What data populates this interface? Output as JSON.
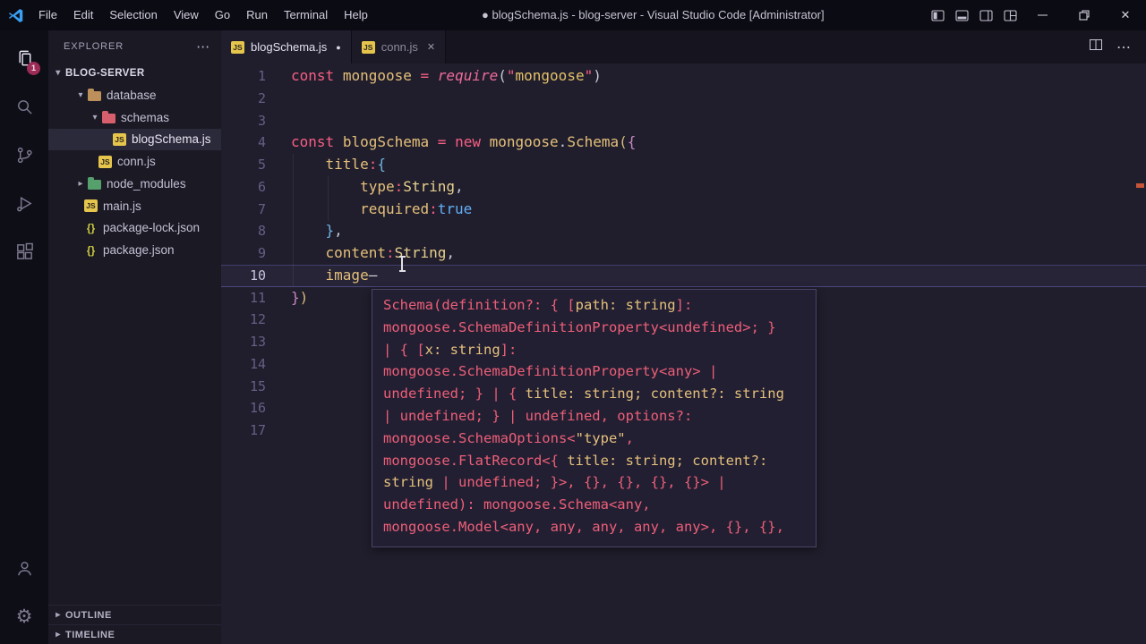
{
  "palette": {
    "titlebar_bg": "#0b0b13",
    "activity_bg": "#0e0e17",
    "sidebar_bg": "#1a1924",
    "sidebar_sel": "#2b2a3a",
    "editor_bg": "#201e2c",
    "tabbar_bg": "#16151f",
    "tab_inactive_fg": "#8d89a0",
    "tab_active_fg": "#e3e0ef",
    "popup_bg": "#221f33",
    "popup_border": "#4a4466",
    "linenum": "#655f85",
    "linenum_active": "#c6c2dd",
    "badge_bg": "#9c2b56",
    "tok_keyword": "#f85e84",
    "tok_ident": "#e5c07b",
    "tok_fn": "#ef6b9a",
    "tok_type": "#e8d08f",
    "tok_string": "#e3c06a",
    "tok_bool": "#64aef5",
    "tok_punct": "#c5cad6",
    "tok_brA": "#d7ba7d",
    "tok_brB": "#c586c0",
    "tok_brC": "#6fb3e0",
    "tok_cursor": "#dcdce4",
    "hint_red": "#ee5f77",
    "hint_yellow": "#e5c07b",
    "ruler_mark": "#c5543a"
  },
  "icons": {
    "more_h": "⋯",
    "close": "✕",
    "chevron_down": "▾",
    "chevron_right": "▸",
    "dot": "●",
    "gear": "⚙"
  },
  "titlebar": {
    "menus": [
      "File",
      "Edit",
      "Selection",
      "View",
      "Go",
      "Run",
      "Terminal",
      "Help"
    ],
    "title": "● blogSchema.js - blog-server - Visual Studio Code [Administrator]"
  },
  "activity_bar": {
    "badge": "1",
    "items": [
      "explorer",
      "search",
      "source-control",
      "run-and-debug",
      "extensions"
    ],
    "bottom_items": [
      "accounts",
      "settings"
    ]
  },
  "sidebar": {
    "header": "EXPLORER",
    "root_label": "BLOG-SERVER",
    "items": [
      {
        "label": "database",
        "kind": "folder",
        "depth": 1,
        "expanded": true,
        "color": "#bd8f5a"
      },
      {
        "label": "schemas",
        "kind": "folder",
        "depth": 2,
        "expanded": true,
        "color": "#d75f6d"
      },
      {
        "label": "blogSchema.js",
        "kind": "js",
        "depth": 3,
        "selected": true
      },
      {
        "label": "conn.js",
        "kind": "js",
        "depth": 2
      },
      {
        "label": "node_modules",
        "kind": "folder",
        "depth": 1,
        "expanded": false,
        "color": "#56a06d"
      },
      {
        "label": "main.js",
        "kind": "js",
        "depth": 1
      },
      {
        "label": "package-lock.json",
        "kind": "json",
        "depth": 1
      },
      {
        "label": "package.json",
        "kind": "json",
        "depth": 1
      }
    ],
    "sections": [
      "OUTLINE",
      "TIMELINE"
    ]
  },
  "editor": {
    "tabs": [
      {
        "label": "blogSchema.js",
        "modified": true,
        "active": true
      },
      {
        "label": "conn.js",
        "modified": false,
        "active": false
      }
    ],
    "active_line": 10,
    "lines": [
      {
        "segs": [
          [
            "kw",
            "const"
          ],
          [
            "",
            " "
          ],
          [
            "id",
            "mongoose"
          ],
          [
            "",
            " "
          ],
          [
            "kw",
            "="
          ],
          [
            "",
            " "
          ],
          [
            "fn",
            "require"
          ],
          [
            "pn",
            "("
          ],
          [
            "kw",
            "\""
          ],
          [
            "str",
            "mongoose"
          ],
          [
            "kw",
            "\""
          ],
          [
            "pn",
            ")"
          ]
        ]
      },
      {
        "segs": []
      },
      {
        "segs": []
      },
      {
        "segs": [
          [
            "kw",
            "const"
          ],
          [
            "",
            " "
          ],
          [
            "id",
            "blogSchema"
          ],
          [
            "",
            " "
          ],
          [
            "kw",
            "="
          ],
          [
            "",
            " "
          ],
          [
            "kw",
            "new"
          ],
          [
            "",
            " "
          ],
          [
            "id",
            "mongoose"
          ],
          [
            "pn",
            "."
          ],
          [
            "id",
            "Schema"
          ],
          [
            "brA",
            "("
          ],
          [
            "brB",
            "{"
          ]
        ]
      },
      {
        "segs": [
          [
            "",
            "    "
          ],
          [
            "id",
            "title"
          ],
          [
            "kw",
            ":"
          ],
          [
            "brC",
            "{"
          ]
        ]
      },
      {
        "segs": [
          [
            "",
            "        "
          ],
          [
            "id",
            "type"
          ],
          [
            "kw",
            ":"
          ],
          [
            "typ",
            "String"
          ],
          [
            "pn",
            ","
          ]
        ]
      },
      {
        "segs": [
          [
            "",
            "        "
          ],
          [
            "id",
            "required"
          ],
          [
            "kw",
            ":"
          ],
          [
            "bool",
            "true"
          ]
        ]
      },
      {
        "segs": [
          [
            "",
            "    "
          ],
          [
            "brC",
            "}"
          ],
          [
            "pn",
            ","
          ]
        ]
      },
      {
        "segs": [
          [
            "",
            "    "
          ],
          [
            "id",
            "content"
          ],
          [
            "kw",
            ":"
          ],
          [
            "typ",
            "String"
          ],
          [
            "pn",
            ","
          ]
        ]
      },
      {
        "segs": [
          [
            "",
            "    "
          ],
          [
            "id",
            "image"
          ],
          [
            "cur",
            "—"
          ]
        ]
      },
      {
        "segs": [
          [
            "brB",
            "}"
          ],
          [
            "brA",
            ")"
          ]
        ]
      },
      {
        "segs": []
      },
      {
        "segs": []
      },
      {
        "segs": []
      },
      {
        "segs": []
      },
      {
        "segs": []
      },
      {
        "segs": []
      }
    ],
    "param_hint": {
      "lines": [
        [
          [
            "red",
            "Schema(definition?: { ["
          ],
          [
            "yel",
            "path: string"
          ],
          [
            "red",
            "]:"
          ]
        ],
        [
          [
            "red",
            "mongoose.SchemaDefinitionProperty<undefined>; }"
          ]
        ],
        [
          [
            "red",
            "| { ["
          ],
          [
            "yel",
            "x: string"
          ],
          [
            "red",
            "]:"
          ]
        ],
        [
          [
            "red",
            "mongoose.SchemaDefinitionProperty<any> |"
          ]
        ],
        [
          [
            "red",
            "undefined; } | { "
          ],
          [
            "yel",
            "title: string; content?: string"
          ]
        ],
        [
          [
            "red",
            "| undefined; } | undefined, options?:"
          ]
        ],
        [
          [
            "red",
            "mongoose.SchemaOptions<"
          ],
          [
            "yel",
            "\"type\""
          ],
          [
            "red",
            ","
          ]
        ],
        [
          [
            "red",
            "mongoose.FlatRecord<{ "
          ],
          [
            "yel",
            "title: string; content?:"
          ]
        ],
        [
          [
            "yel",
            "string"
          ],
          [
            "red",
            " | undefined; }>, {}, {}, {}, {}> |"
          ]
        ],
        [
          [
            "red",
            "undefined): mongoose.Schema<any,"
          ]
        ],
        [
          [
            "red",
            "mongoose.Model<any, any, any, any, any>, {}, {},"
          ]
        ]
      ]
    }
  }
}
